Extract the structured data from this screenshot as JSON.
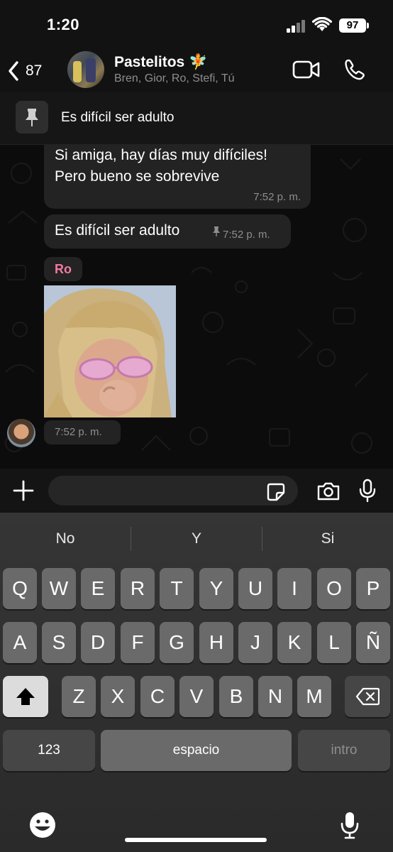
{
  "status_bar": {
    "time": "1:20",
    "battery": "97"
  },
  "header": {
    "back_count": "87",
    "group_name": "Pastelitos 🧚",
    "members": "Bren, Gior, Ro, Stefi, Tú"
  },
  "pinned": {
    "text": "Es difícil ser adulto"
  },
  "messages": [
    {
      "line1": "Si amiga, hay días muy difíciles!",
      "line2": "Pero bueno se sobrevive",
      "time": "7:52 p. m."
    },
    {
      "text": "Es difícil ser adulto",
      "time": "7:52 p. m."
    }
  ],
  "sender": {
    "name": "Ro",
    "color": "#f07aa4"
  },
  "sticker_time": "7:52 p. m.",
  "input": {
    "placeholder": ""
  },
  "keyboard": {
    "suggestions": [
      "No",
      "Y",
      "Si"
    ],
    "row1": [
      "Q",
      "W",
      "E",
      "R",
      "T",
      "Y",
      "U",
      "I",
      "O",
      "P"
    ],
    "row2": [
      "A",
      "S",
      "D",
      "F",
      "G",
      "H",
      "J",
      "K",
      "L",
      "Ñ"
    ],
    "row3": [
      "Z",
      "X",
      "C",
      "V",
      "B",
      "N",
      "M"
    ],
    "numbers_key": "123",
    "space_key": "espacio",
    "return_key": "intro"
  },
  "icons": [
    "back-chevron-icon",
    "video-icon",
    "phone-icon",
    "pin-icon",
    "plus-icon",
    "sticker-icon",
    "camera-icon",
    "microphone-icon",
    "shift-icon",
    "backspace-icon",
    "emoji-icon"
  ]
}
